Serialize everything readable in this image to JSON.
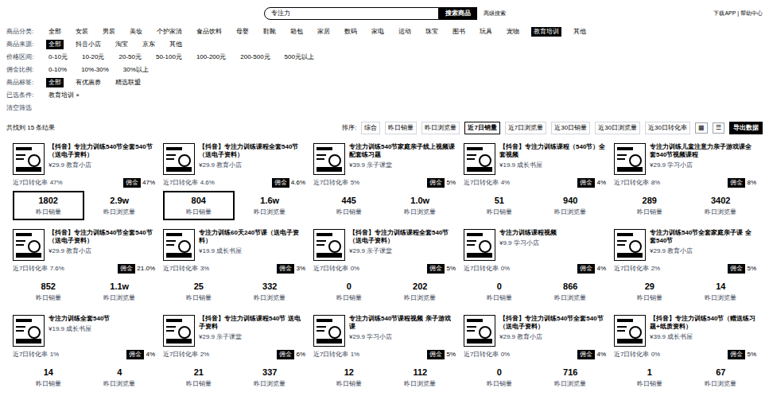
{
  "header": {
    "search_value": "专注力",
    "search_button": "搜索商品",
    "search_link": "高级搜索",
    "right_links": "下载APP | 帮助中心"
  },
  "filters": [
    {
      "label": "商品分类:",
      "options": [
        {
          "text": "全部",
          "selected": false
        },
        {
          "text": "女装",
          "selected": false
        },
        {
          "text": "男装",
          "selected": false
        },
        {
          "text": "美妆",
          "selected": false
        },
        {
          "text": "个护家清",
          "selected": false
        },
        {
          "text": "食品饮料",
          "selected": false
        },
        {
          "text": "母婴",
          "selected": false
        },
        {
          "text": "鞋靴",
          "selected": false
        },
        {
          "text": "箱包",
          "selected": false
        },
        {
          "text": "家居",
          "selected": false
        },
        {
          "text": "数码",
          "selected": false
        },
        {
          "text": "家电",
          "selected": false
        },
        {
          "text": "运动",
          "selected": false
        },
        {
          "text": "珠宝",
          "selected": false
        },
        {
          "text": "图书",
          "selected": false
        },
        {
          "text": "玩具",
          "selected": false
        },
        {
          "text": "宠物",
          "selected": false
        },
        {
          "text": "教育培训",
          "selected": true
        },
        {
          "text": "其他",
          "selected": false
        }
      ]
    },
    {
      "label": "商品来源:",
      "options": [
        {
          "text": "全部",
          "selected": true
        },
        {
          "text": "抖音小店",
          "selected": false
        },
        {
          "text": "淘宝",
          "selected": false
        },
        {
          "text": "京东",
          "selected": false
        },
        {
          "text": "其他",
          "selected": false
        }
      ]
    },
    {
      "label": "价格区间:",
      "options": [
        {
          "text": "0-10元",
          "selected": false
        },
        {
          "text": "10-20元",
          "selected": false
        },
        {
          "text": "20-50元",
          "selected": false
        },
        {
          "text": "50-100元",
          "selected": false
        },
        {
          "text": "100-200元",
          "selected": false
        },
        {
          "text": "200-500元",
          "selected": false
        },
        {
          "text": "500元以上",
          "selected": false
        }
      ]
    },
    {
      "label": "佣金比例:",
      "options": [
        {
          "text": "0-10%",
          "selected": false
        },
        {
          "text": "10%-30%",
          "selected": false
        },
        {
          "text": "30%以上",
          "selected": false
        }
      ]
    },
    {
      "label": "商品标签:",
      "options": [
        {
          "text": "全部",
          "selected": true
        },
        {
          "text": "有优惠券",
          "selected": false
        },
        {
          "text": "精选联盟",
          "selected": false
        }
      ]
    },
    {
      "label": "已选条件:",
      "options": [
        {
          "text": "教育培训 ×",
          "selected": false
        }
      ]
    }
  ],
  "clear_filters": "清空筛选",
  "toolbar": {
    "result": "共找到 15 条结果",
    "sort_label": "排序:",
    "sort_options": [
      {
        "text": "综合",
        "selected": false
      },
      {
        "text": "昨日销量",
        "selected": false
      },
      {
        "text": "昨日浏览量",
        "selected": false
      },
      {
        "text": "近7日销量",
        "selected": true
      },
      {
        "text": "近7日浏览量",
        "selected": false
      },
      {
        "text": "近30日销量",
        "selected": false
      },
      {
        "text": "近30日浏览量",
        "selected": false
      },
      {
        "text": "近30日转化率",
        "selected": false
      }
    ],
    "views": [
      {
        "text": "▦",
        "selected": false
      },
      {
        "text": "☰",
        "selected": false
      }
    ],
    "export": "导出数据"
  },
  "cards": [
    {
      "title": "【抖音】专注力训练540节全套540节（送电子资料）",
      "price": "¥29.9",
      "shop": "教育小店",
      "metric": "近7日转化率 47%",
      "tag": "佣金",
      "percent": "47%",
      "highlighted": true,
      "stats": [
        {
          "value": "1802",
          "label": "昨日销量"
        },
        {
          "value": "2.9w",
          "label": "昨日浏览量"
        }
      ]
    },
    {
      "title": "【抖音】专注力训练课程全套540节（送电子资料）",
      "price": "¥29.9",
      "shop": "教育小店",
      "metric": "近7日转化率 4.6%",
      "tag": "佣金",
      "percent": "4.6%",
      "highlighted": true,
      "stats": [
        {
          "value": "804",
          "label": "昨日销量"
        },
        {
          "value": "1.6w",
          "label": "昨日浏览量"
        }
      ]
    },
    {
      "title": "专注力训练540节家庭亲子线上视频课 配套练习题",
      "price": "¥39.9",
      "shop": "亲子课堂",
      "metric": "近7日转化率 5%",
      "tag": "佣金",
      "percent": "5%",
      "highlighted": false,
      "stats": [
        {
          "value": "445",
          "label": "昨日销量"
        },
        {
          "value": "1.0w",
          "label": "昨日浏览量"
        }
      ]
    },
    {
      "title": "【抖音】专注力训练课程（540节）全套视频",
      "price": "¥19.9",
      "shop": "成长书屋",
      "metric": "近7日转化率 4%",
      "tag": "佣金",
      "percent": "4%",
      "highlighted": false,
      "stats": [
        {
          "value": "51",
          "label": "昨日销量"
        },
        {
          "value": "940",
          "label": "昨日浏览量"
        }
      ]
    },
    {
      "title": "专注力训练儿童注意力亲子游戏课全套540节视频课程",
      "price": "¥29.9",
      "shop": "学习小店",
      "metric": "近7日转化率 8%",
      "tag": "佣金",
      "percent": "8%",
      "highlighted": false,
      "stats": [
        {
          "value": "289",
          "label": "昨日销量"
        },
        {
          "value": "3402",
          "label": "昨日浏览量"
        }
      ]
    },
    {
      "title": "【抖音】专注力训练540节全套540节（送电子资料）",
      "price": "¥29.9",
      "shop": "教育小店",
      "metric": "近7日转化率 7.6%",
      "tag": "佣金",
      "percent": "21.0%",
      "highlighted": false,
      "stats": [
        {
          "value": "852",
          "label": "昨日销量"
        },
        {
          "value": "1.1w",
          "label": "昨日浏览量"
        }
      ]
    },
    {
      "title": "专注力训练60天240节课（送电子资料）",
      "price": "¥19.9",
      "shop": "成长书屋",
      "metric": "近7日转化率 3%",
      "tag": "佣金",
      "percent": "3%",
      "highlighted": false,
      "stats": [
        {
          "value": "25",
          "label": "昨日销量"
        },
        {
          "value": "332",
          "label": "昨日浏览量"
        }
      ]
    },
    {
      "title": "【抖音】专注力训练课程全套540节（送电子资料）",
      "price": "¥29.9",
      "shop": "亲子课堂",
      "metric": "近7日转化率 0%",
      "tag": "佣金",
      "percent": "5%",
      "highlighted": false,
      "stats": [
        {
          "value": "0",
          "label": "昨日销量"
        },
        {
          "value": "202",
          "label": "昨日浏览量"
        }
      ]
    },
    {
      "title": "专注力训练课程视频",
      "price": "¥9.9",
      "shop": "学习小店",
      "metric": "近7日转化率 0%",
      "tag": "佣金",
      "percent": "4%",
      "highlighted": false,
      "stats": [
        {
          "value": "0",
          "label": "昨日销量"
        },
        {
          "value": "866",
          "label": "昨日浏览量"
        }
      ]
    },
    {
      "title": "专注力训练540节全套家庭亲子课 全套540节",
      "price": "¥29.9",
      "shop": "教育小店",
      "metric": "近7日转化率 2%",
      "tag": "佣金",
      "percent": "5%",
      "highlighted": false,
      "stats": [
        {
          "value": "29",
          "label": "昨日销量"
        },
        {
          "value": "14",
          "label": "昨日浏览量"
        }
      ]
    },
    {
      "title": "专注力训练全套540节",
      "price": "¥19.9",
      "shop": "成长书屋",
      "metric": "近7日转化率 1%",
      "tag": "佣金",
      "percent": "4%",
      "highlighted": false,
      "stats": [
        {
          "value": "14",
          "label": "昨日销量"
        },
        {
          "value": "4",
          "label": "昨日浏览量"
        }
      ]
    },
    {
      "title": "【抖音】专注力训练课程540节 送电子资料",
      "price": "¥29.9",
      "shop": "亲子课堂",
      "metric": "近7日转化率 2%",
      "tag": "佣金",
      "percent": "6%",
      "highlighted": false,
      "stats": [
        {
          "value": "21",
          "label": "昨日销量"
        },
        {
          "value": "337",
          "label": "昨日浏览量"
        }
      ]
    },
    {
      "title": "专注力训练540节课程视频 亲子游戏课",
      "price": "¥29.9",
      "shop": "学习小店",
      "metric": "近7日转化率 1%",
      "tag": "佣金",
      "percent": "5%",
      "highlighted": false,
      "stats": [
        {
          "value": "12",
          "label": "昨日销量"
        },
        {
          "value": "112",
          "label": "昨日浏览量"
        }
      ]
    },
    {
      "title": "【抖音】专注力训练540节全套540节（送电子资料）",
      "price": "¥29.9",
      "shop": "教育小店",
      "metric": "近7日转化率 0%",
      "tag": "佣金",
      "percent": "4%",
      "highlighted": false,
      "stats": [
        {
          "value": "0",
          "label": "昨日销量"
        },
        {
          "value": "716",
          "label": "昨日浏览量"
        }
      ]
    },
    {
      "title": "【抖音】专注力训练540节（赠送练习题+纸质资料）",
      "price": "¥39.9",
      "shop": "成长书屋",
      "metric": "近7日转化率 0%",
      "tag": "佣金",
      "percent": "5%",
      "highlighted": false,
      "stats": [
        {
          "value": "1",
          "label": "昨日销量"
        },
        {
          "value": "67",
          "label": "昨日浏览量"
        }
      ]
    }
  ]
}
